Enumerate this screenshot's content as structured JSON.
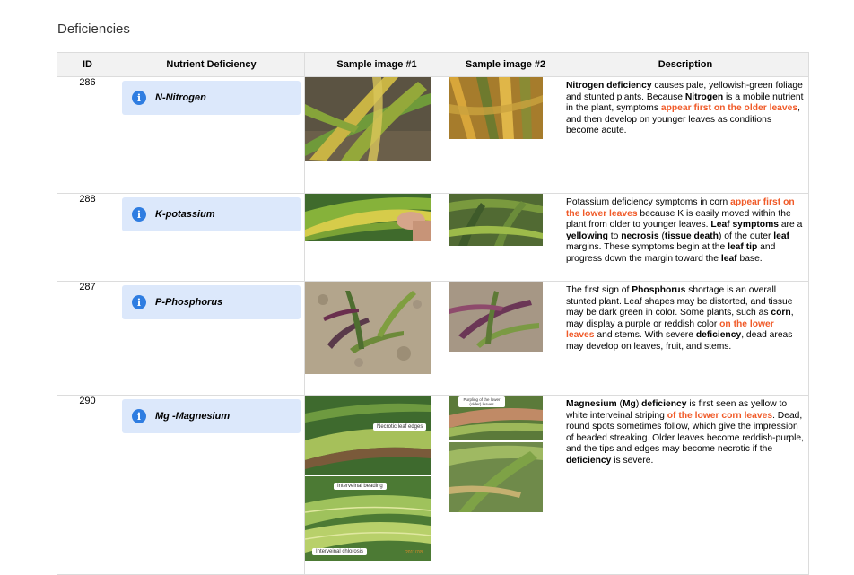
{
  "page": {
    "title": "Deficiencies"
  },
  "table": {
    "headers": [
      "ID",
      "Nutrient Deficiency",
      "Sample image #1",
      "Sample image #2",
      "Description"
    ],
    "rows": [
      {
        "id": "286",
        "nutrient": "N-Nitrogen",
        "description": [
          {
            "t": "Nitrogen deficiency",
            "s": "b"
          },
          {
            "t": " causes pale, yellowish-green foliage and stunted plants. Because "
          },
          {
            "t": "Nitrogen",
            "s": "b"
          },
          {
            "t": " is a mobile nutrient in the plant, symptoms "
          },
          {
            "t": "appear first on the older leaves",
            "s": "hl"
          },
          {
            "t": ", and then develop on younger leaves as conditions become acute."
          }
        ]
      },
      {
        "id": "288",
        "nutrient": "K-potassium",
        "description": [
          {
            "t": "Potassium deficiency symptoms in corn "
          },
          {
            "t": "appear first on the lower leaves",
            "s": "hl"
          },
          {
            "t": " because K is easily moved within the plant from older to younger leaves. "
          },
          {
            "t": "Leaf symptoms",
            "s": "b"
          },
          {
            "t": " are a "
          },
          {
            "t": "yellowing",
            "s": "b"
          },
          {
            "t": " to "
          },
          {
            "t": "necrosis",
            "s": "b"
          },
          {
            "t": " ("
          },
          {
            "t": "tissue death",
            "s": "b"
          },
          {
            "t": ") of the outer "
          },
          {
            "t": "leaf",
            "s": "b"
          },
          {
            "t": " margins. These symptoms begin at the "
          },
          {
            "t": "leaf tip",
            "s": "b"
          },
          {
            "t": " and progress down the margin toward the "
          },
          {
            "t": "leaf",
            "s": "b"
          },
          {
            "t": " base."
          }
        ]
      },
      {
        "id": "287",
        "nutrient": "P-Phosphorus",
        "description": [
          {
            "t": "The first sign of "
          },
          {
            "t": "Phosphorus",
            "s": "b"
          },
          {
            "t": " shortage is an overall stunted plant. Leaf shapes may be distorted, and tissue may be dark green in color. Some plants, such as "
          },
          {
            "t": "corn",
            "s": "b"
          },
          {
            "t": ", may display a purple or reddish color "
          },
          {
            "t": "on the lower leaves",
            "s": "hl"
          },
          {
            "t": " and stems. With severe "
          },
          {
            "t": "deficiency",
            "s": "b"
          },
          {
            "t": ", dead areas may develop on leaves, fruit, and stems."
          }
        ]
      },
      {
        "id": "290",
        "nutrient": "Mg -Magnesium",
        "description": [
          {
            "t": "Magnesium",
            "s": "b"
          },
          {
            "t": " ("
          },
          {
            "t": "Mg",
            "s": "b"
          },
          {
            "t": ") "
          },
          {
            "t": "deficiency",
            "s": "b"
          },
          {
            "t": " is first seen as yellow to white interveinal striping "
          },
          {
            "t": "of the lower corn leaves",
            "s": "hl"
          },
          {
            "t": ". Dead, round spots sometimes follow, which give the impression of beaded streaking. Older leaves become reddish-purple, and the tips and edges may become necrotic if the "
          },
          {
            "t": "deficiency",
            "s": "b"
          },
          {
            "t": " is severe."
          }
        ]
      }
    ]
  },
  "photo_labels": {
    "necrotic": "Necrotic leaf edges",
    "beading": "Interveinal beading",
    "chlorosis": "Interveinal chlorosis",
    "purpling": "Purpling of the lower (older) leaves",
    "stamp": "2011/7/8"
  },
  "colors": {
    "header_bg": "#f2f2f2",
    "nutrient_bg": "#dce8fb",
    "info_icon": "#2f7de1",
    "highlight": "#f05a28"
  },
  "icons": {
    "info": "info-circle-icon"
  }
}
